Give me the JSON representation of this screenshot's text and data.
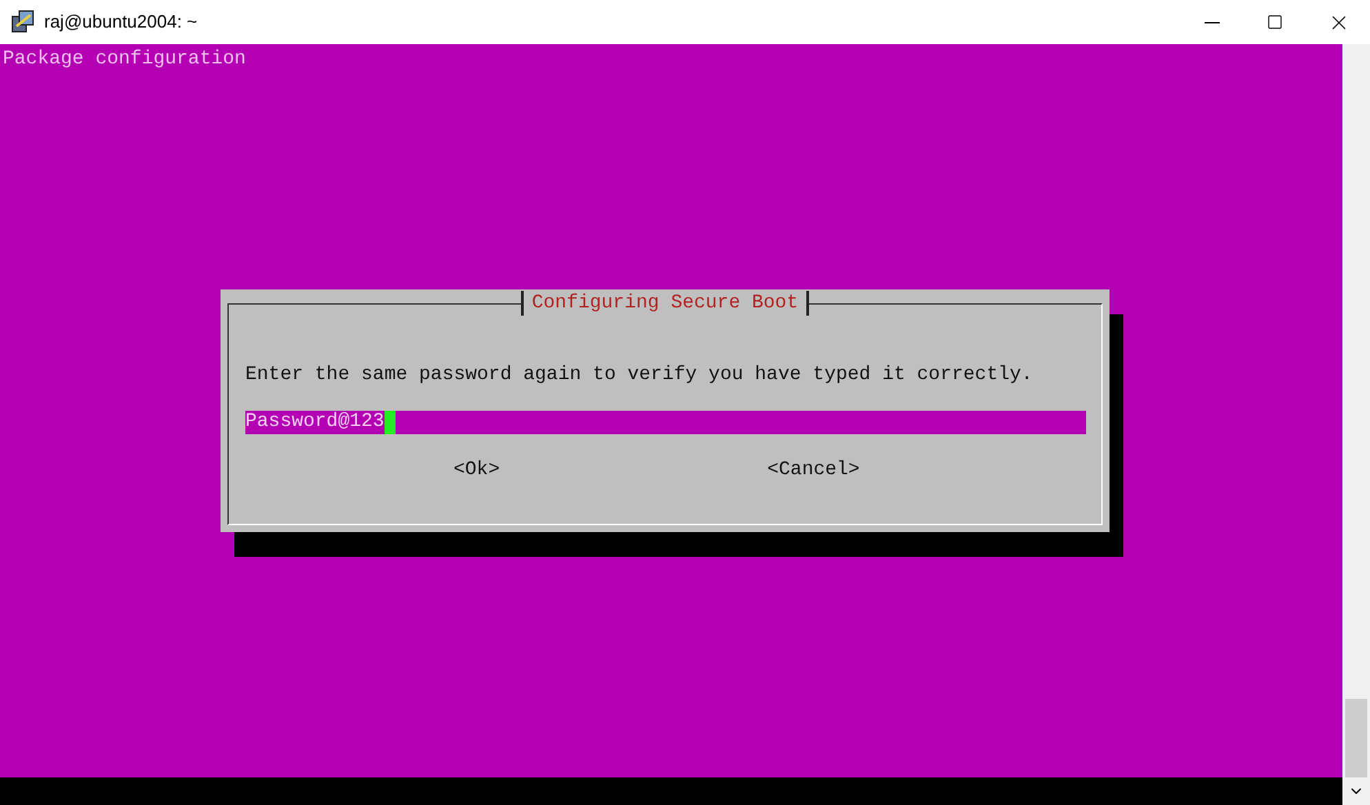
{
  "window": {
    "title": "raj@ubuntu2004: ~"
  },
  "terminal": {
    "header": "Package configuration"
  },
  "dialog": {
    "title": "Configuring Secure Boot",
    "message": "Enter the same password again to verify you have typed it correctly.",
    "field": {
      "value": "Password@123"
    },
    "buttons": [
      "<Ok>",
      "<Cancel>"
    ]
  }
}
